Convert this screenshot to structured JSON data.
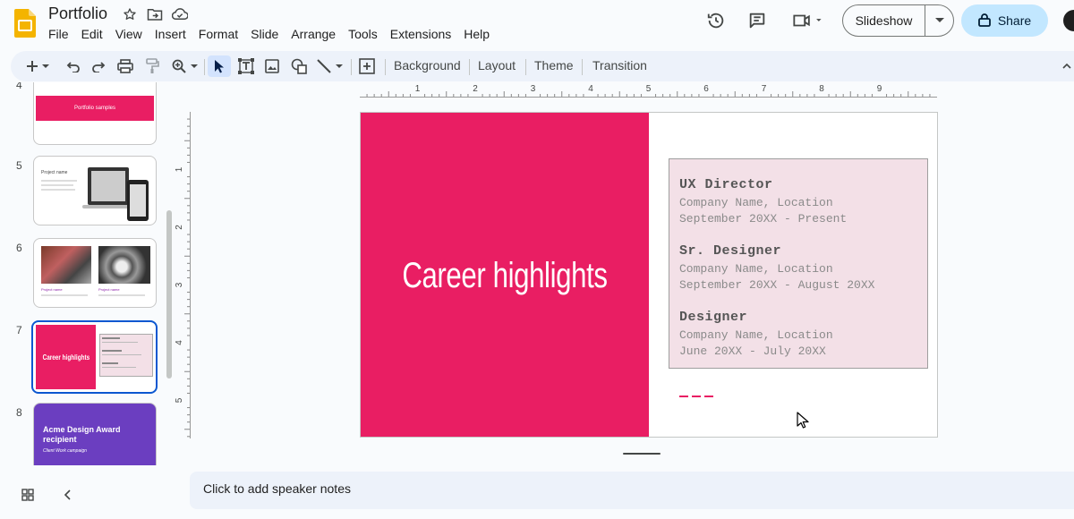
{
  "app": {
    "doc_title": "Portfolio",
    "menu": [
      "File",
      "Edit",
      "View",
      "Insert",
      "Format",
      "Slide",
      "Arrange",
      "Tools",
      "Extensions",
      "Help"
    ],
    "slideshow_label": "Slideshow",
    "share_label": "Share",
    "accent": "#e91e63",
    "share_bg": "#c2e7ff"
  },
  "toolbar": {
    "background_label": "Background",
    "layout_label": "Layout",
    "theme_label": "Theme",
    "transition_label": "Transition"
  },
  "ruler": {
    "h_labels": [
      "1",
      "2",
      "3",
      "4",
      "5",
      "6",
      "7",
      "8",
      "9"
    ],
    "v_labels": [
      "1",
      "2",
      "3",
      "4",
      "5"
    ]
  },
  "filmstrip": {
    "slides": [
      {
        "number": "4",
        "text": "Portfolio samples"
      },
      {
        "number": "5",
        "text": "Project name"
      },
      {
        "number": "6",
        "text": "Project name"
      },
      {
        "number": "7",
        "text": "Career highlights"
      },
      {
        "number": "8",
        "text": "Acme Design Award recipient",
        "sub": "Client Work campaign"
      }
    ]
  },
  "slide": {
    "heading": "Career highlights",
    "jobs": [
      {
        "role": "UX Director",
        "company": "Company Name, Location",
        "dates": "September 20XX - Present"
      },
      {
        "role": "Sr. Designer",
        "company": "Company Name, Location",
        "dates": "September 20XX - August 20XX"
      },
      {
        "role": "Designer",
        "company": "Company Name, Location",
        "dates": "June 20XX - July 20XX"
      }
    ]
  },
  "notes": {
    "placeholder": "Click to add speaker notes"
  }
}
